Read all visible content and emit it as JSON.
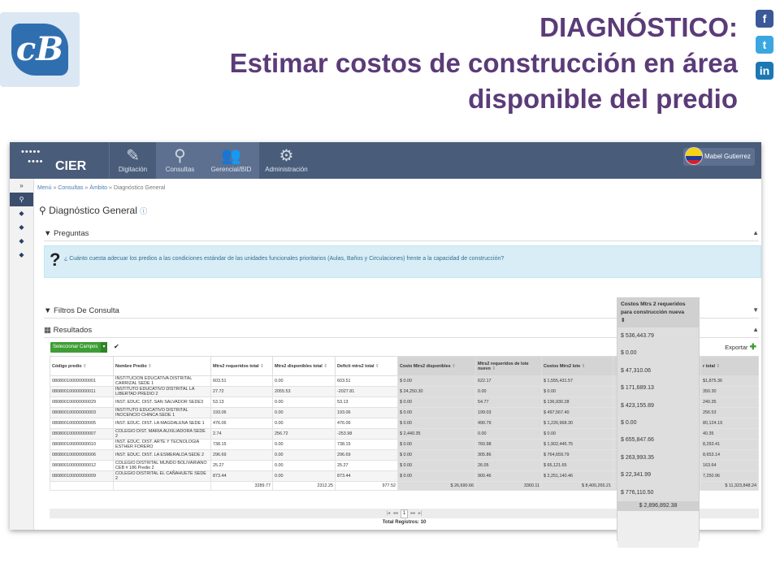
{
  "slide": {
    "title_line1": "DIAGNÓSTICO:",
    "title_line2": "Estimar costos de construcción  en área",
    "title_line3": "disponible del predio",
    "logo_glyph": "cB",
    "social": [
      "f",
      "t",
      "in"
    ]
  },
  "app": {
    "brand_name": "CIER",
    "nav": [
      {
        "label": "Digitación",
        "icon": "pencil-icon",
        "glyph": "✎"
      },
      {
        "label": "Consultas",
        "icon": "search-icon",
        "glyph": "⚲"
      },
      {
        "label": "Gerencial/BID",
        "icon": "users-icon",
        "glyph": "👥"
      },
      {
        "label": "Administración",
        "icon": "gears-icon",
        "glyph": "⚙"
      }
    ],
    "user_name": "Mabel Gutierrez",
    "breadcrumb": {
      "menu": "Menú",
      "sep1": "»",
      "consultas": "Consultas",
      "sep2": "»",
      "ambito": "Ámbito",
      "sep3": "»",
      "current": "Diagnóstico General"
    },
    "page_title": "Diagnóstico General",
    "panels": {
      "preguntas": "Preguntas",
      "filtros": "Filtros De Consulta",
      "resultados": "Resultados"
    },
    "question_text": "¿ Cuánto cuesta adecuar los predios a las condiciones estándar de las unidades funcionales prioritarios (Aulas, Baños y Circulaciones) frente a la capacidad de construcción?",
    "select_fields_label": "Seleccionar Campos",
    "export_label": "Exportar",
    "columns": [
      "Código predio",
      "Nombre Predio",
      "Mtrs2 requeridos total",
      "Mtrs2 disponibles total",
      "Deficit mtrs2 total",
      "Costo Mtrs2 disponibles",
      "Mtrs2 requeridos de lote nuevo",
      "Costos Mtrs2 lote",
      "Costos Mtrs 2 requeridos para construcción nueva",
      "r total"
    ],
    "rows": [
      [
        "080800100000000001",
        "INSTITUCION EDUCATIVA DISTRITAL CARRIZAL SEDE 1",
        "603.51",
        "0.00",
        "603.51",
        "$ 0.00",
        "622.17",
        "$ 1,555,431.57",
        "",
        "$1,875.36"
      ],
      [
        "080800100000000011",
        "INSTITUTO EDUCATIVO DISTRITAL LA LIBERTAD PREDIO 2",
        "27.72",
        "2055.53",
        "-2027.81",
        "$ 24,250.30",
        "0.00",
        "$ 0.00",
        "",
        "350.30"
      ],
      [
        "080800100000000029",
        "INST. EDUC. DIST. SAN SALVADOR SEDE3",
        "53.13",
        "0.00",
        "53.13",
        "$ 0.00",
        "54.77",
        "$ 136,930.28",
        "",
        "240.35"
      ],
      [
        "080800100000000003",
        "INSTITUTO EDUCATIVO DISTRITAL INOCENCIO CHINCA SEDE 1",
        "193.06",
        "0.00",
        "193.06",
        "$ 0.00",
        "199.03",
        "$ 497,567.40",
        "",
        "256.53"
      ],
      [
        "080800100000000005",
        "INST. EDUC. DIST. LA MAGDALENA SEDE 1",
        "476.06",
        "0.00",
        "476.06",
        "$ 0.00",
        "490.79",
        "$ 1,226,968.30",
        "",
        "80,124.19"
      ],
      [
        "080800100000000007",
        "COLEGIO DIST. MARIA AUXILIADORA SEDE 2",
        "2.74",
        "256.72",
        "-253.98",
        "$ 2,440.35",
        "0.00",
        "$ 0.00",
        "",
        "40.35"
      ],
      [
        "080800100000000010",
        "INST. EDUC. DIST. ARTE Y TECNOLOGIA ESTHER FORERO",
        "738.15",
        "0.00",
        "738.15",
        "$ 0.00",
        "760.98",
        "$ 1,902,445.75",
        "",
        "8,293.41"
      ],
      [
        "080800100000000006",
        "INST. EDUC. DIST. LA ESMERALDA SEDE 2",
        "296.69",
        "0.00",
        "296.69",
        "$ 0.00",
        "305.86",
        "$ 764,659.79",
        "",
        "8,653.14"
      ],
      [
        "080800100000000012",
        "COLEGIO DISTRITAL MUNDO BOLIVARIANO CEB # 186 Predio 2",
        "25.27",
        "0.00",
        "25.27",
        "$ 0.00",
        "26.05",
        "$ 65,121.65",
        "",
        "163.64"
      ],
      [
        "080800100000000009",
        "COLEGIO DISTRITAL EL CAÑAHUETE SEDE 2",
        "873.44",
        "0.00",
        "873.44",
        "$ 0.00",
        "900.46",
        "$ 2,251,140.46",
        "",
        "7,250.96"
      ]
    ],
    "totals": [
      "",
      "",
      "3289.77",
      "2312.25",
      "977.52",
      "$ 26,690.66",
      "3360.11",
      "$ 8,400,265.21",
      "",
      "$ 11,323,848.24"
    ],
    "pager": {
      "first": "|◂",
      "prev": "◂◂",
      "page": "1",
      "next": "▸▸",
      "last": "▸|"
    },
    "total_records": "Total Registros: 10",
    "overlay": {
      "header": "Costos Mtrs 2 requeridos para construcción nueva",
      "values": [
        "$ 536,443.79",
        "$ 0.00",
        "$ 47,310.06",
        "$ 171,689.13",
        "$ 423,155.89",
        "$ 0.00",
        "$ 655,847.66",
        "$ 263,993.35",
        "$ 22,341.99",
        "$ 776,110.50"
      ],
      "total": "$ 2,896,892.38"
    }
  }
}
